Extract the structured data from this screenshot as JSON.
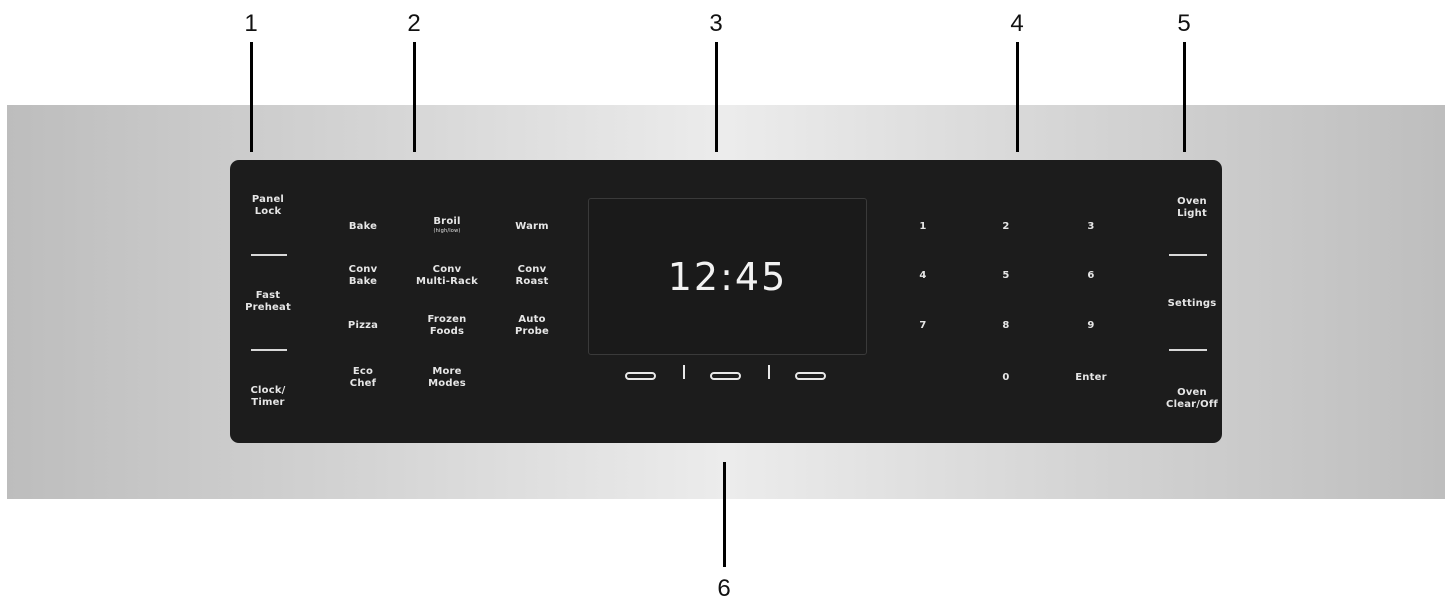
{
  "callouts": [
    "1",
    "2",
    "3",
    "4",
    "5",
    "6"
  ],
  "left_column": {
    "panel_lock": [
      "Panel",
      "Lock"
    ],
    "fast_preheat": [
      "Fast",
      "Preheat"
    ],
    "clock_timer": [
      "Clock/",
      "Timer"
    ]
  },
  "modes": {
    "bake": "Bake",
    "broil": "Broil",
    "broil_sub": "(high/low)",
    "warm": "Warm",
    "conv_bake": [
      "Conv",
      "Bake"
    ],
    "conv_multi_rack": [
      "Conv",
      "Multi-Rack"
    ],
    "conv_roast": [
      "Conv",
      "Roast"
    ],
    "pizza": "Pizza",
    "frozen_foods": [
      "Frozen",
      "Foods"
    ],
    "auto_probe": [
      "Auto",
      "Probe"
    ],
    "eco_chef": [
      "Eco",
      "Chef"
    ],
    "more_modes": [
      "More",
      "Modes"
    ]
  },
  "display": {
    "time": "12:45"
  },
  "keypad": [
    "1",
    "2",
    "3",
    "4",
    "5",
    "6",
    "7",
    "8",
    "9",
    "0",
    "Enter"
  ],
  "right_column": {
    "oven_light": [
      "Oven",
      "Light"
    ],
    "settings": "Settings",
    "oven_clear_off": [
      "Oven",
      "Clear/Off"
    ]
  }
}
